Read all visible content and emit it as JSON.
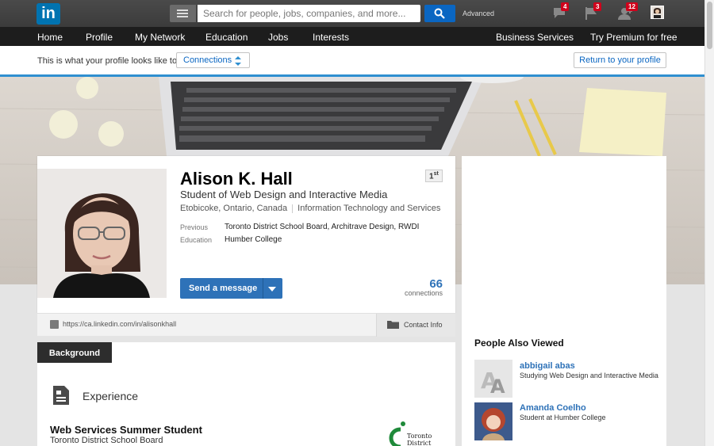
{
  "topbar": {
    "logo": "in",
    "search_placeholder": "Search for people, jobs, companies, and more...",
    "advanced": "Advanced",
    "messages_count": "4",
    "flags_count": "3",
    "connections_count": "12"
  },
  "nav": {
    "items": [
      "Home",
      "Profile",
      "My Network",
      "Education",
      "Jobs",
      "Interests"
    ],
    "business": "Business Services",
    "premium": "Try Premium for free"
  },
  "profile_bar": {
    "text": "This is what your profile looks like to",
    "select": "Connections",
    "return": "Return to your profile"
  },
  "profile": {
    "name": "Alison K. Hall",
    "degree": "1",
    "degree_suffix": "st",
    "headline": "Student of Web Design and Interactive Media",
    "location": "Etobicoke, Ontario, Canada",
    "industry": "Information Technology and Services",
    "previous_label": "Previous",
    "previous_value": "Toronto District School Board, Architrave Design, RWDI",
    "education_label": "Education",
    "education_value": "Humber College",
    "send_button": "Send a message",
    "connections_number": "66",
    "connections_label": "connections",
    "url": "https://ca.linkedin.com/in/alisonkhall",
    "contact_info": "Contact Info"
  },
  "sidebar": {
    "title": "People Also Viewed",
    "people": [
      {
        "name": "abbigail abas",
        "desc": "Studying Web Design and Interactive Media"
      },
      {
        "name": "Amanda Coelho",
        "desc": "Student at Humber College"
      }
    ]
  },
  "background": {
    "tab": "Background",
    "experience": "Experience",
    "job_title": "Web Services Summer Student",
    "company": "Toronto District School Board",
    "logo_text_1": "Toronto",
    "logo_text_2": "District"
  },
  "colors": {
    "linkedin_blue": "#0073b1",
    "accent_blue": "#2e72b8",
    "badge_red": "#d0021b"
  }
}
